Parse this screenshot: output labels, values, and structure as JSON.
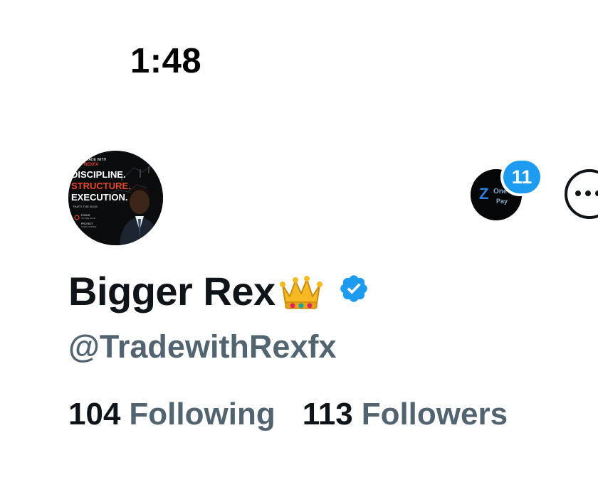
{
  "status_bar": {
    "time": "1:48"
  },
  "profile": {
    "avatar": {
      "alt": "profile-avatar",
      "text_lines": [
        "TRADE WITH",
        "REXFX",
        "DISCIPLINE.",
        "STRUCTURE.",
        "EXECUTION.",
        "THAT'S THE EDGE.",
        "FOCUS",
        "ON THE PLAN",
        "PROTECT",
        "YOUR CAPITAL"
      ]
    },
    "linked_account": {
      "icon": "zone-pay-logo",
      "logo_text_1": "Z",
      "logo_text_2": "One",
      "logo_text_3": "Pay",
      "badge_count": "11"
    },
    "more_button": {
      "icon": "ellipsis-icon"
    },
    "display_name": "Bigger Rex",
    "name_emoji": "crown-icon",
    "verified": true,
    "handle": "@TradewithRexfx",
    "following_count": "104",
    "following_label": "Following",
    "followers_count": "113",
    "followers_label": "Followers"
  },
  "colors": {
    "primary_text": "#0f1419",
    "secondary_text": "#536471",
    "accent_blue": "#1d9bf0",
    "avatar_orange": "#e8462b"
  }
}
